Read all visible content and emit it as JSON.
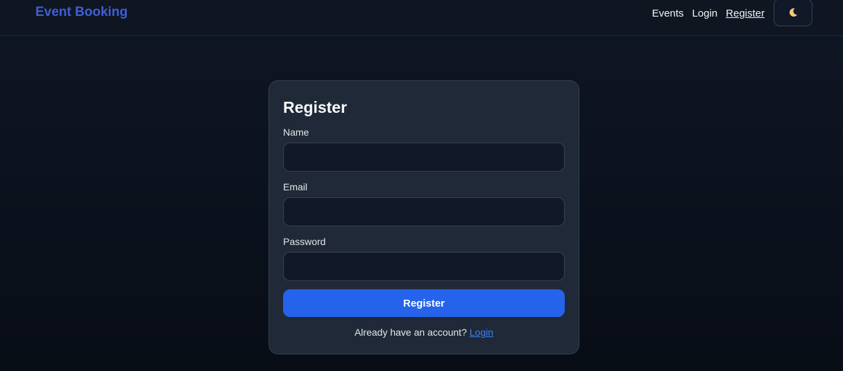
{
  "navbar": {
    "brand": "Event Booking",
    "links": [
      {
        "label": "Events"
      },
      {
        "label": "Login"
      },
      {
        "label": "Register"
      }
    ],
    "theme_toggle_icon": "moon-icon"
  },
  "form": {
    "title": "Register",
    "fields": [
      {
        "label": "Name",
        "value": "",
        "placeholder": ""
      },
      {
        "label": "Email",
        "value": "",
        "placeholder": ""
      },
      {
        "label": "Password",
        "value": "",
        "placeholder": ""
      }
    ],
    "submit_label": "Register",
    "footer_text": "Already have an account?",
    "footer_link": "Login"
  },
  "colors": {
    "brand": "#3f5fd6",
    "primary_button": "#2563eb",
    "link": "#3b82f6",
    "card_bg": "#1f2937",
    "page_bg": "#0b111c"
  }
}
